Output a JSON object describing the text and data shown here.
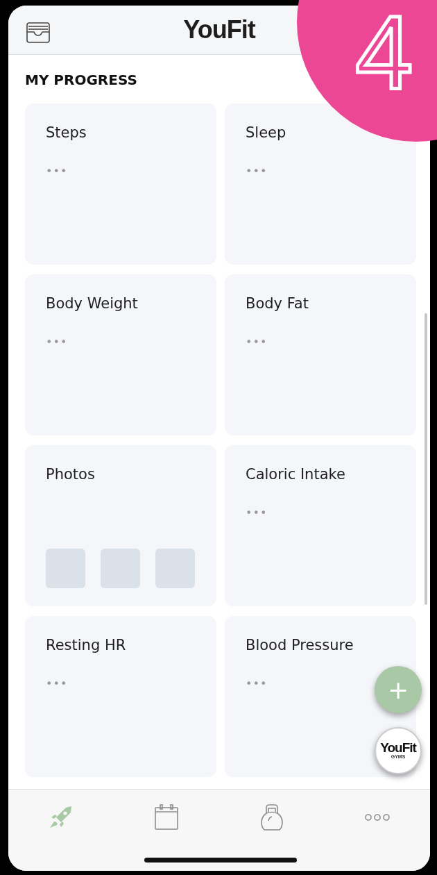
{
  "header": {
    "title": "YouFit"
  },
  "section_title": "MY PROGRESS",
  "cards": [
    {
      "kind": "metric",
      "title": "Steps",
      "value": "•••"
    },
    {
      "kind": "metric",
      "title": "Sleep",
      "value": "•••"
    },
    {
      "kind": "metric",
      "title": "Body Weight",
      "value": "•••"
    },
    {
      "kind": "metric",
      "title": "Body Fat",
      "value": "•••"
    },
    {
      "kind": "photos",
      "title": "Photos"
    },
    {
      "kind": "metric",
      "title": "Caloric Intake",
      "value": "•••"
    },
    {
      "kind": "metric",
      "title": "Resting HR",
      "value": "•••"
    },
    {
      "kind": "metric",
      "title": "Blood Pressure",
      "value": "•••"
    }
  ],
  "add_button": {
    "label": "+"
  },
  "gym_logo": {
    "name": "YouFit",
    "sub": "GYMS"
  },
  "nav": [
    {
      "kind": "rocket",
      "selected": true
    },
    {
      "kind": "calendar",
      "selected": false
    },
    {
      "kind": "kettlebell",
      "selected": false
    },
    {
      "kind": "more",
      "selected": false
    }
  ],
  "step_badge": {
    "label": "4"
  }
}
